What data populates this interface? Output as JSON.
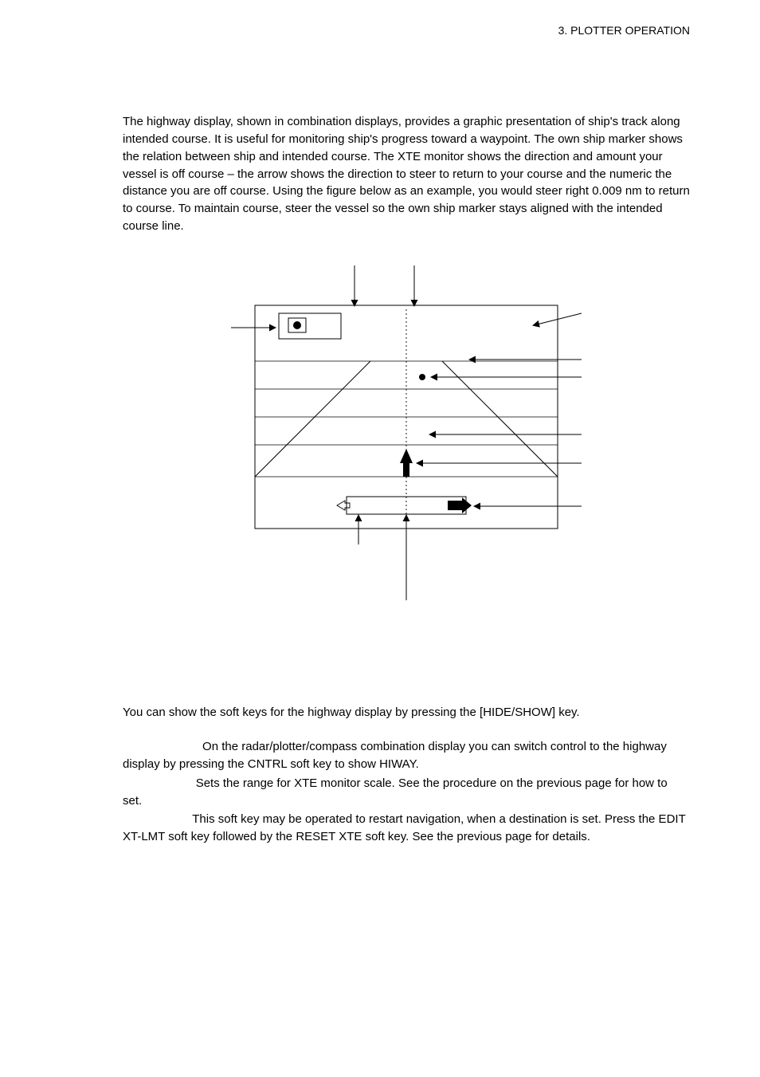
{
  "header": {
    "section": "3. PLOTTER OPERATION"
  },
  "intro": {
    "paragraph": "The highway display, shown in combination displays, provides a graphic presentation of ship's track along intended course. It is useful for monitoring ship's progress toward a waypoint. The own ship marker shows the relation between ship and intended course. The XTE monitor shows the direction and amount your vessel is off course – the arrow shows the direction to steer to return to your course and the numeric the distance you are off course. Using the figure below as an example, you would steer right 0.009 nm to return to course. To maintain course, steer the vessel so the own ship marker stays aligned with the intended course line."
  },
  "softkeys": {
    "intro": "You can show the soft keys for the highway display by pressing the [HIDE/SHOW] key.",
    "items": [
      {
        "lead": "                        ",
        "text": "On the radar/plotter/compass combination display you can switch control to the highway display by pressing the CNTRL soft key to show HIWAY."
      },
      {
        "lead": "                      ",
        "text": "Sets the range for XTE monitor scale. See the procedure on the previous page for how to set."
      },
      {
        "lead": "                     ",
        "text": "This soft key may be operated to restart navigation, when a destination is set. Press the EDIT XT-LMT soft key followed by the RESET XTE soft key. See the previous page for details."
      }
    ]
  }
}
